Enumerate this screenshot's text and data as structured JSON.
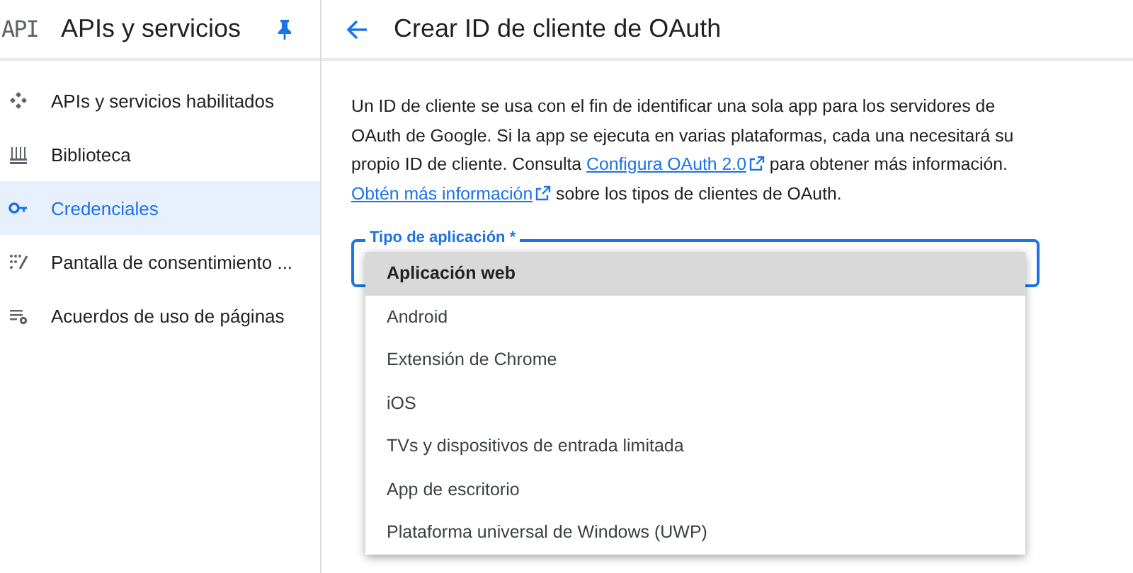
{
  "sidebar": {
    "logo": "API",
    "title": "APIs y servicios",
    "items": [
      {
        "label": "APIs y servicios habilitados",
        "selected": false
      },
      {
        "label": "Biblioteca",
        "selected": false
      },
      {
        "label": "Credenciales",
        "selected": true
      },
      {
        "label": "Pantalla de consentimiento ...",
        "selected": false
      },
      {
        "label": "Acuerdos de uso de páginas",
        "selected": false
      }
    ]
  },
  "page": {
    "title": "Crear ID de cliente de OAuth",
    "description": [
      {
        "kind": "text",
        "text": "Un ID de cliente se usa con el fin de identificar una sola app para los servidores de OAuth de Google. Si la app se ejecuta en varias plataformas, cada una necesitará su propio ID de cliente. Consulta "
      },
      {
        "kind": "link",
        "text": "Configura OAuth 2.0"
      },
      {
        "kind": "text",
        "text": " para obtener más información. "
      },
      {
        "kind": "link",
        "text": "Obtén más información"
      },
      {
        "kind": "text",
        "text": " sobre los tipos de clientes de OAuth."
      }
    ],
    "field": {
      "label": "Tipo de aplicación *",
      "options": [
        {
          "label": "Aplicación web",
          "selected": true
        },
        {
          "label": "Android",
          "selected": false
        },
        {
          "label": "Extensión de Chrome",
          "selected": false
        },
        {
          "label": "iOS",
          "selected": false
        },
        {
          "label": "TVs y dispositivos de entrada limitada",
          "selected": false
        },
        {
          "label": "App de escritorio",
          "selected": false
        },
        {
          "label": "Plataforma universal de Windows (UWP)",
          "selected": false
        }
      ]
    }
  }
}
